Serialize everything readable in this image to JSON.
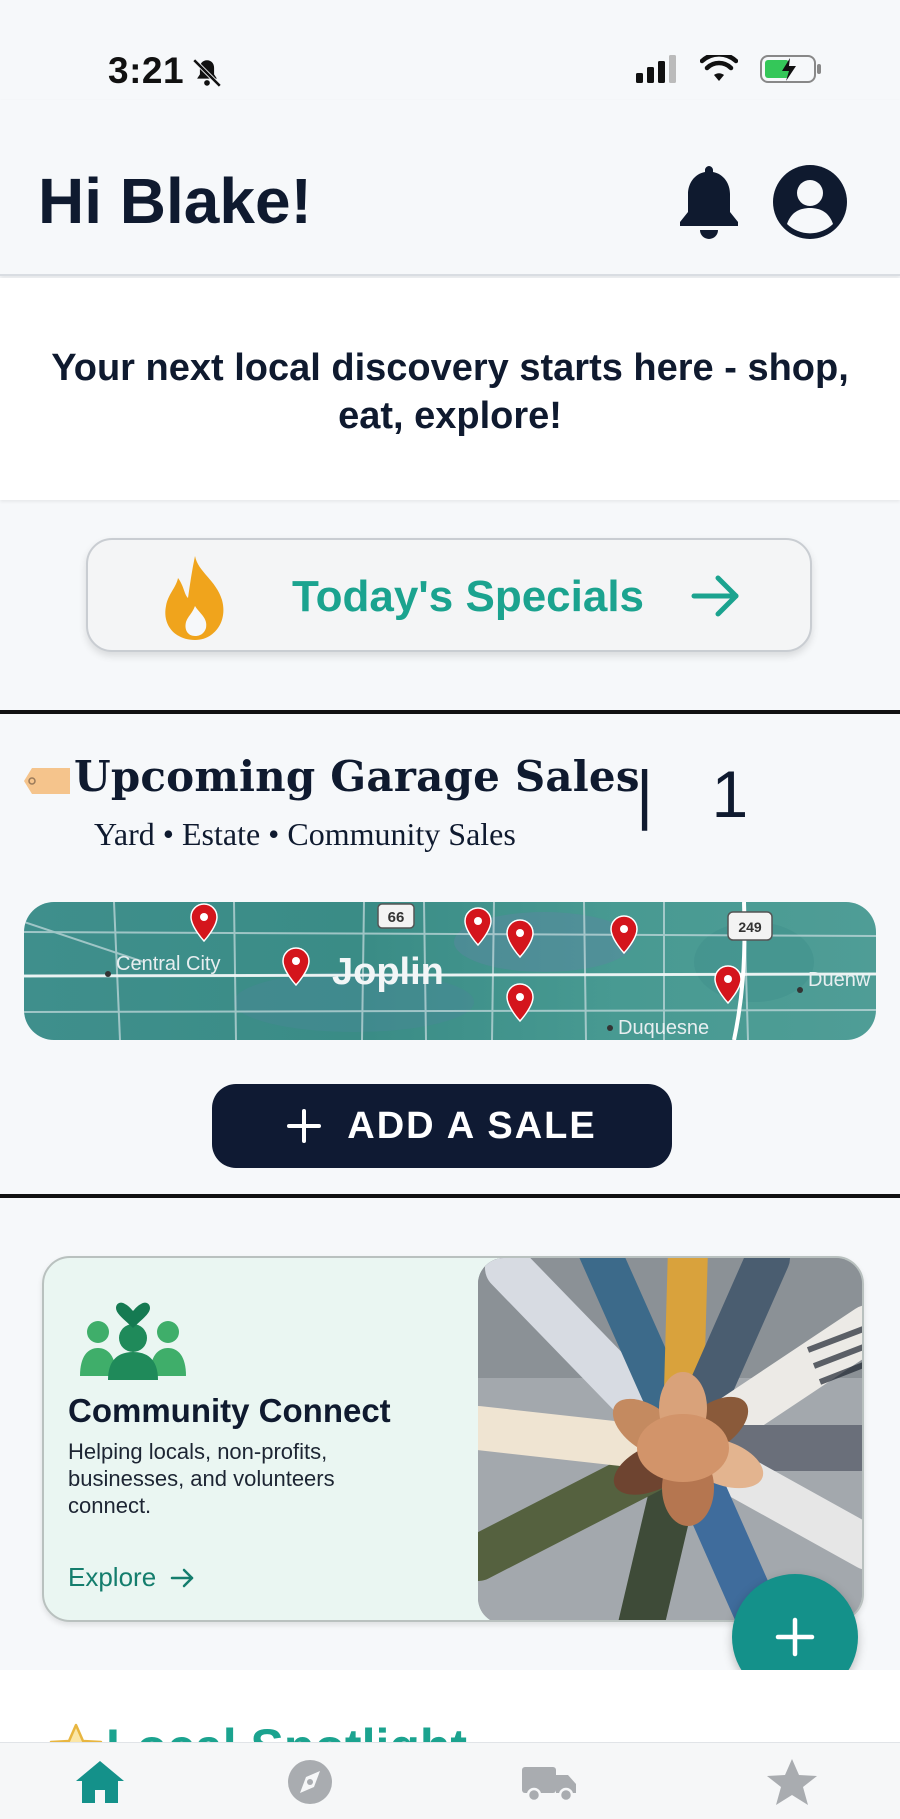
{
  "status_bar": {
    "time": "3:21",
    "icons": [
      "bell-muted-icon",
      "signal-icon",
      "wifi-icon",
      "battery-charging-icon"
    ]
  },
  "header": {
    "greeting": "Hi Blake!",
    "icons": [
      "bell-icon",
      "account-icon"
    ]
  },
  "tagline": "Your next local discovery starts here - shop, eat, explore!",
  "specials": {
    "label": "Today's Specials",
    "icon": "fire-icon",
    "arrow": "arrow-right-icon"
  },
  "garage_sales": {
    "title": "Upcoming Garage Sales",
    "subtitle": "Yard • Estate • Community Sales",
    "count_text": "| 1",
    "map": {
      "labels": [
        "Central City",
        "Joplin",
        "Duquesne",
        "Duenw"
      ],
      "route_shields": [
        "66",
        "249"
      ]
    },
    "add_button": "ADD A SALE"
  },
  "community": {
    "title": "Community Connect",
    "description": "Helping locals, non-profits, businesses, and volunteers connect.",
    "link": "Explore"
  },
  "spotlight": {
    "title": "Local Spotlight"
  },
  "bottom_nav": {
    "items": [
      "home-icon",
      "compass-icon",
      "truck-icon",
      "star-icon"
    ],
    "active": "home-icon"
  },
  "colors": {
    "navy": "#0f1a2f",
    "teal": "#1ba38f",
    "fab_teal": "#14918a",
    "fire_orange": "#f0a41c"
  }
}
